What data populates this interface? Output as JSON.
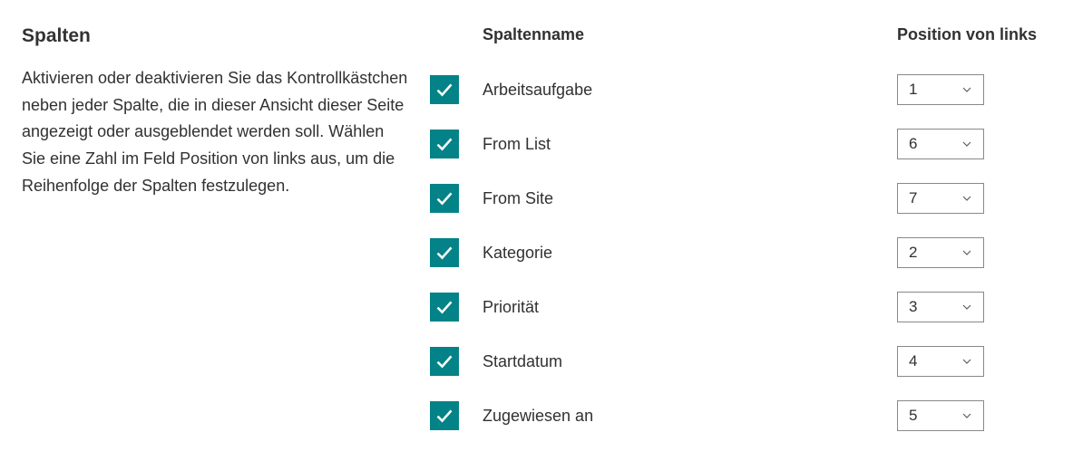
{
  "section": {
    "title": "Spalten",
    "description": "Aktivieren oder deaktivieren Sie das Kontrollkästchen neben jeder Spalte, die in dieser Ansicht dieser Seite angezeigt oder ausgeblendet werden soll. Wählen Sie eine Zahl im Feld Position von links aus, um die Reihenfolge der Spalten festzulegen."
  },
  "headers": {
    "name": "Spaltenname",
    "position": "Position von links"
  },
  "columns": [
    {
      "label": "Arbeitsaufgabe",
      "checked": true,
      "position": "1"
    },
    {
      "label": "From List",
      "checked": true,
      "position": "6"
    },
    {
      "label": "From Site",
      "checked": true,
      "position": "7"
    },
    {
      "label": "Kategorie",
      "checked": true,
      "position": "2"
    },
    {
      "label": "Priorität",
      "checked": true,
      "position": "3"
    },
    {
      "label": "Startdatum",
      "checked": true,
      "position": "4"
    },
    {
      "label": "Zugewiesen an",
      "checked": true,
      "position": "5"
    }
  ]
}
